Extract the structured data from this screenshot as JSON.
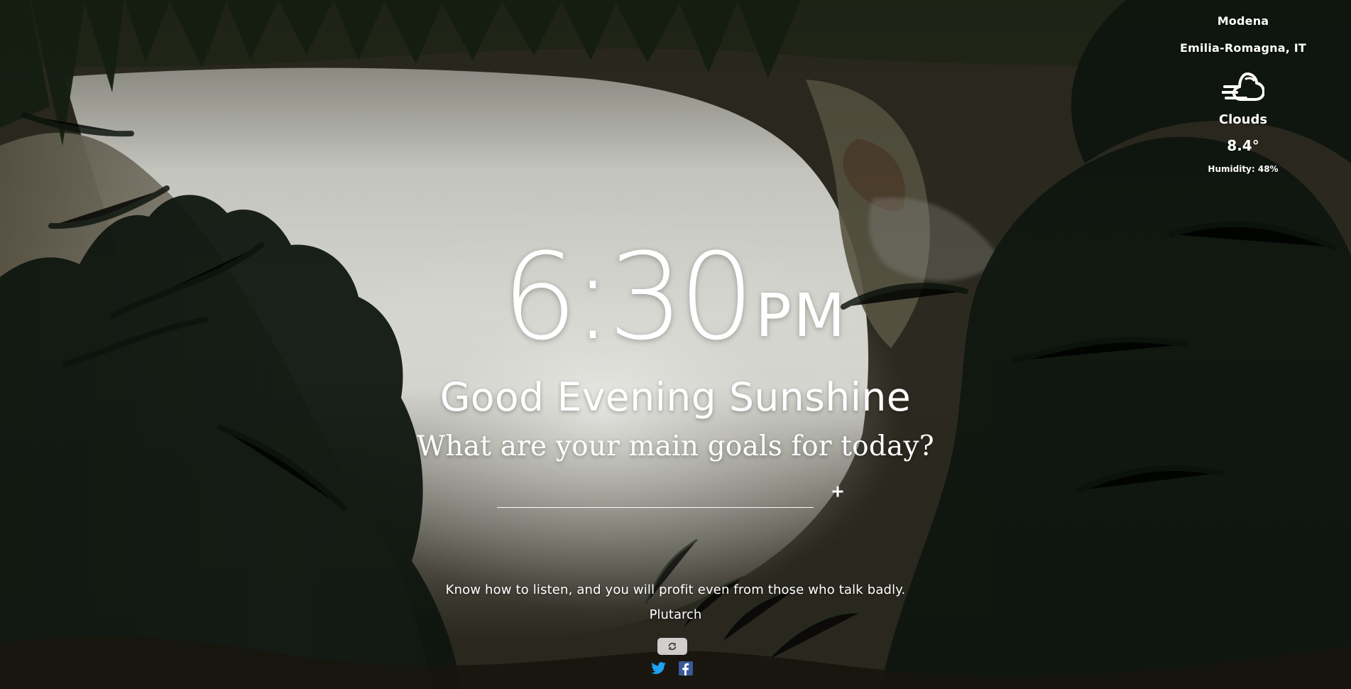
{
  "weather": {
    "city": "Modena",
    "region": "Emilia-Romagna, IT",
    "icon": "cloud-wind-icon",
    "description": "Clouds",
    "temperature": "8.4°",
    "humidity": "Humidity: 48%"
  },
  "clock": {
    "time": "6:30",
    "period": "PM"
  },
  "greeting": {
    "text": "Good Evening Sunshine",
    "prompt": "What are your main goals for today?"
  },
  "goals": {
    "input_value": "",
    "add_icon": "plus-icon"
  },
  "quote": {
    "text": "Know how to listen, and you will profit even from those who talk badly.",
    "author": "Plutarch",
    "refresh_icon": "refresh-icon"
  },
  "social": {
    "twitter_icon": "twitter-icon",
    "facebook_icon": "facebook-icon"
  },
  "colors": {
    "text": "#ffffff",
    "twitter": "#1da1f2",
    "facebook": "#3b5998"
  }
}
